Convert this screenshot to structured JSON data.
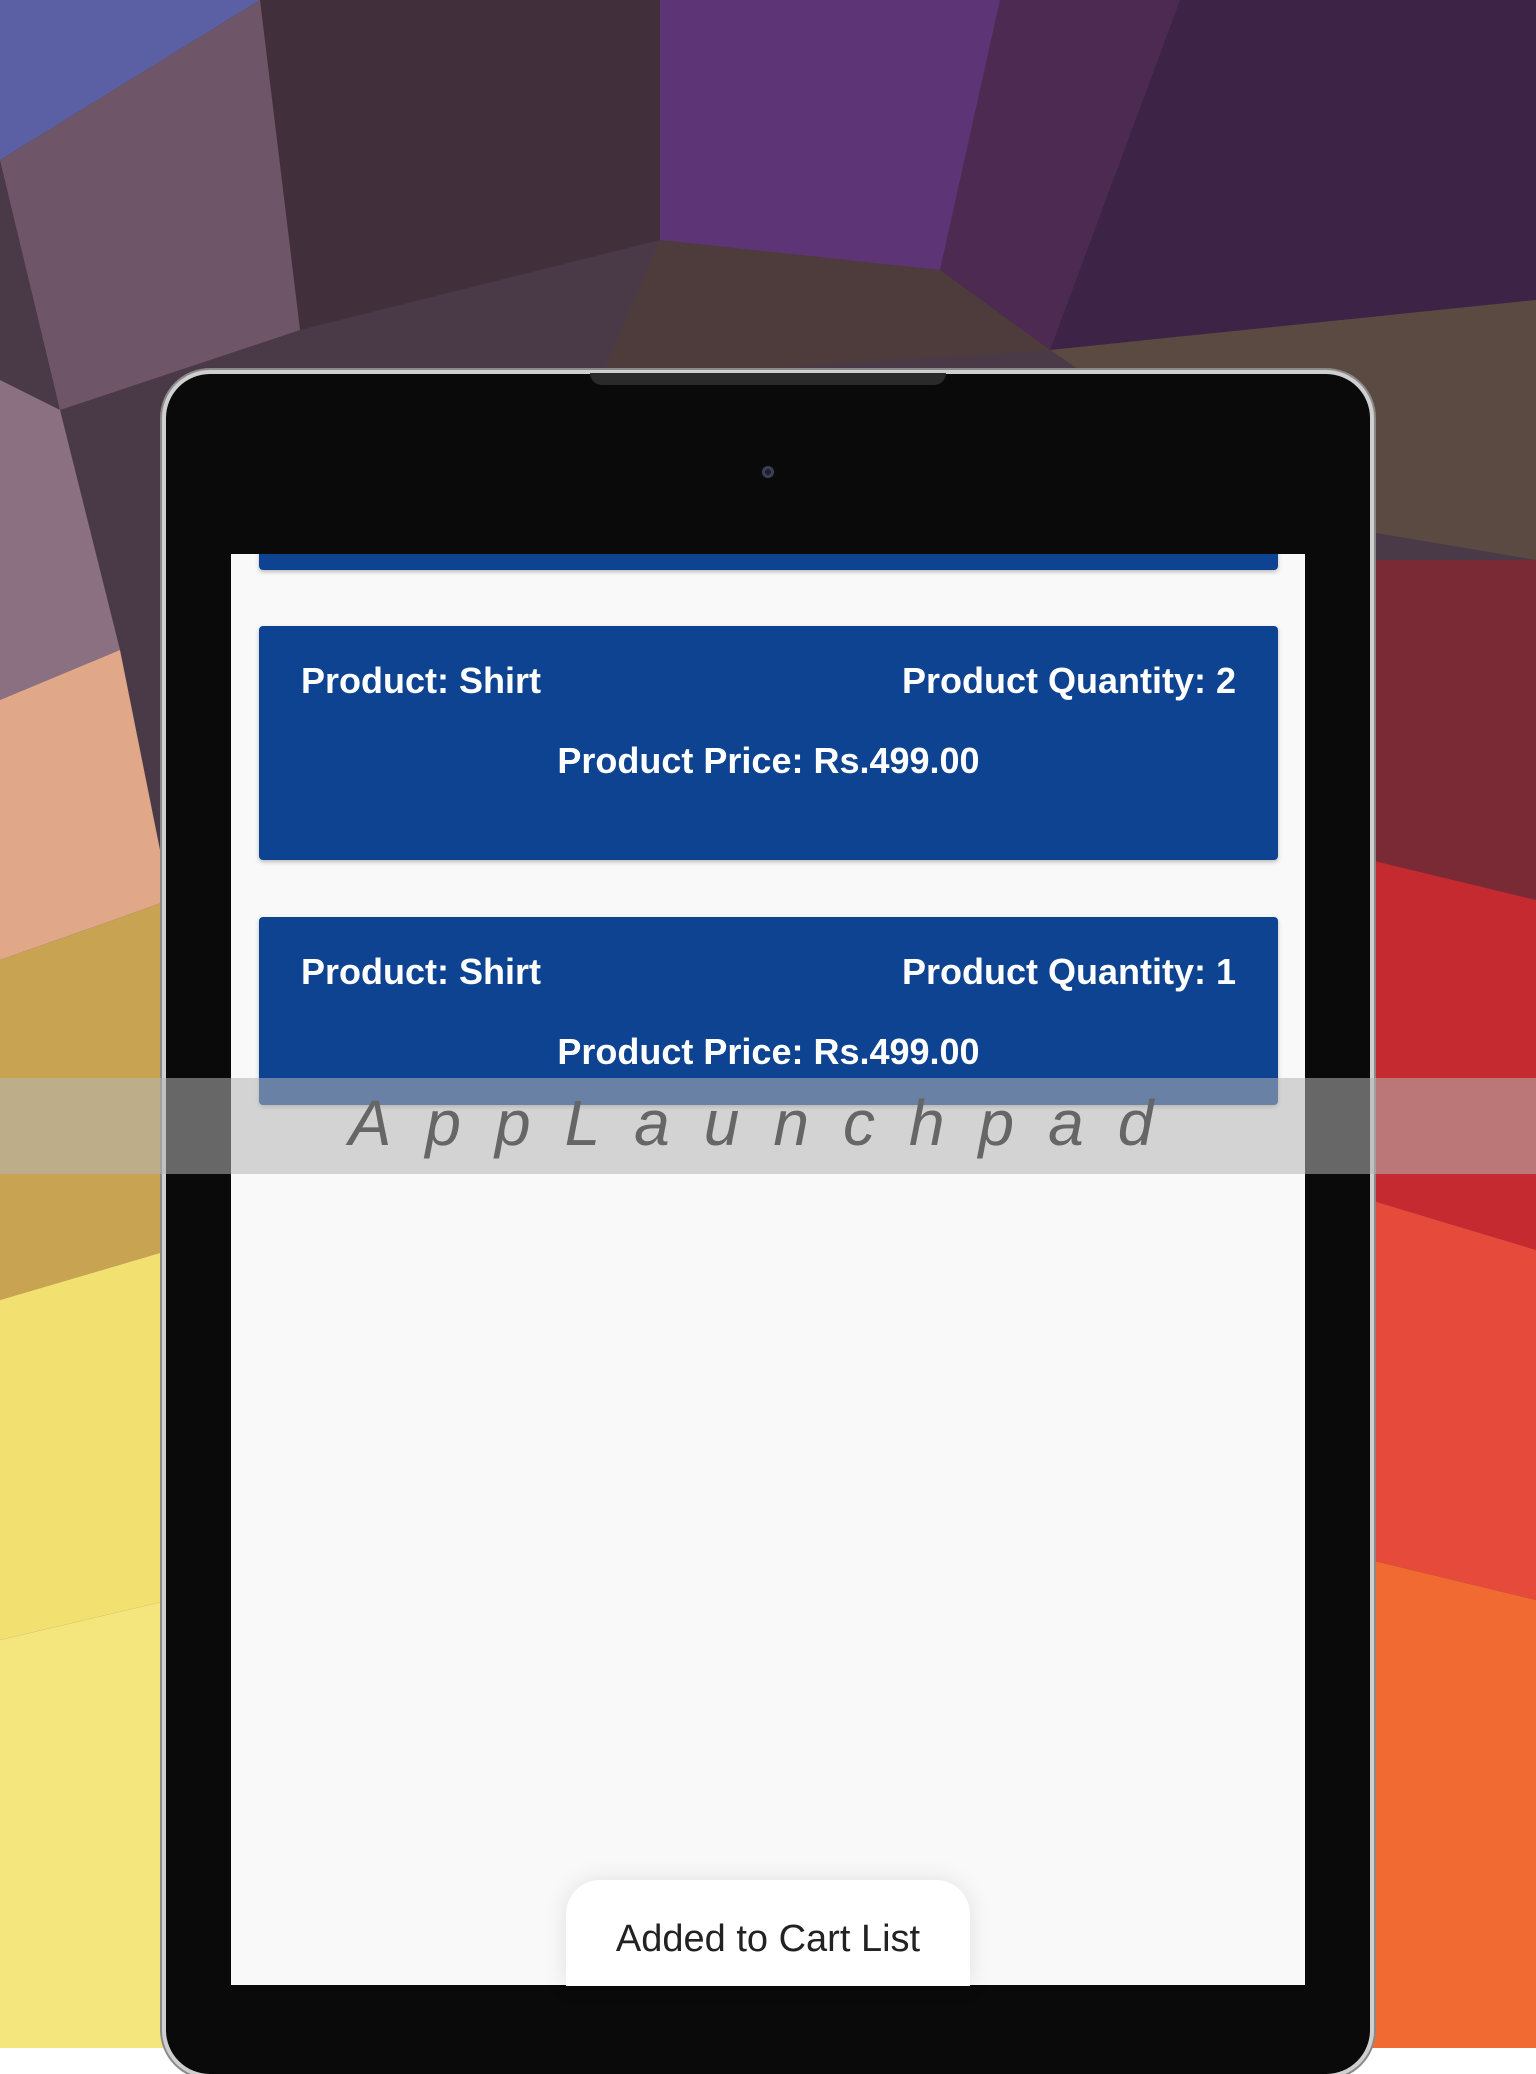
{
  "cart_items": [
    {
      "product": "Product: Shirt",
      "quantity": "Product Quantity: 2",
      "price": "Product Price: Rs.499.00"
    },
    {
      "product": "Product: Shirt",
      "quantity": "Product Quantity: 1",
      "price": "Product Price: Rs.499.00"
    }
  ],
  "watermark": "AppLaunchpad",
  "toast": "Added to Cart List",
  "colors": {
    "card": "#0e4391",
    "screen_bg": "#f9f9f9",
    "card_text": "#ffffff"
  }
}
